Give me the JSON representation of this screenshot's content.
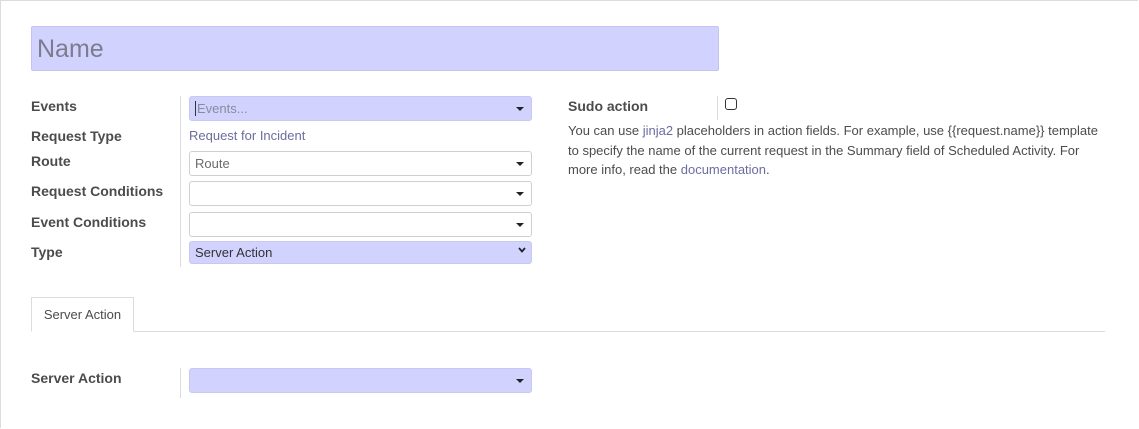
{
  "name_field": {
    "value": "Name"
  },
  "form": {
    "events": {
      "label": "Events",
      "placeholder": "Events..."
    },
    "request_type": {
      "label": "Request Type",
      "value": "Request for Incident"
    },
    "route": {
      "label": "Route",
      "value": "Route"
    },
    "request_conditions": {
      "label": "Request Conditions",
      "value": ""
    },
    "event_conditions": {
      "label": "Event Conditions",
      "value": ""
    },
    "type": {
      "label": "Type",
      "value": "Server Action"
    }
  },
  "sudo": {
    "label": "Sudo action",
    "checked": false,
    "help_prefix": "You can use ",
    "help_link1": "jinja2",
    "help_middle": " placeholders in action fields. For example, use {{request.name}} template to specify the name of the current request in the Summary field of Scheduled Activity. For more info, read the ",
    "help_link2": "documentation",
    "help_suffix": "."
  },
  "tabs": [
    {
      "label": "Server Action",
      "active": true
    }
  ],
  "server_action_section": {
    "label": "Server Action",
    "value": ""
  },
  "colors": {
    "accent_fill": "#d2d2ff",
    "link": "#6c6ca0"
  }
}
